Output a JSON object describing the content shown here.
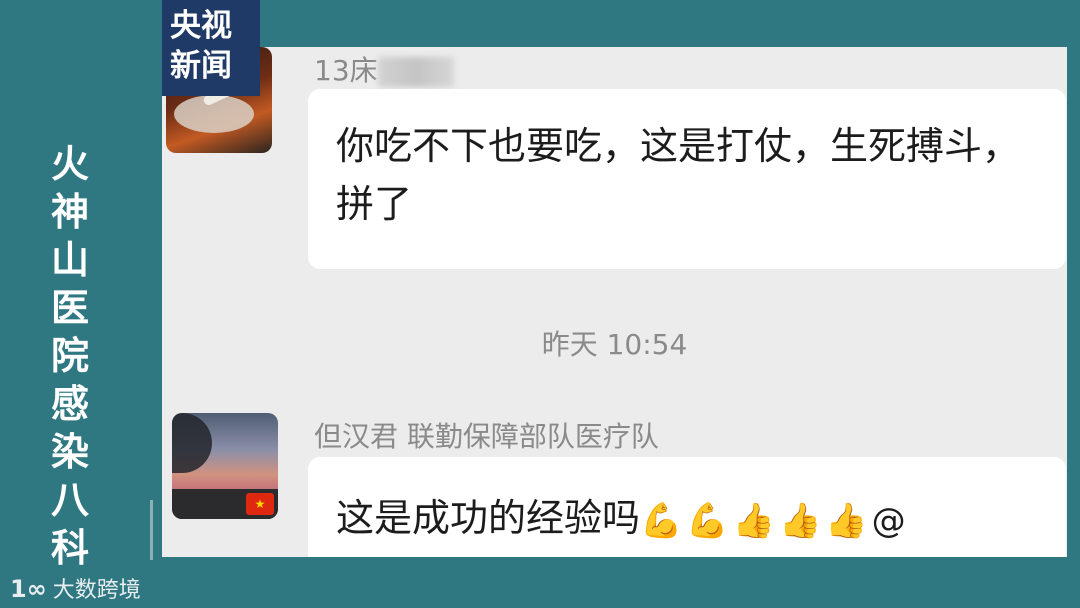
{
  "broadcaster_logo": {
    "line1": "央视",
    "line2": "新闻"
  },
  "side_caption": "火神山医院感染八科",
  "chat": {
    "messages": [
      {
        "sender": "13床",
        "sender_blurred": true,
        "text": "你吃不下也要吃，这是打仗，生死搏斗，拼了"
      },
      {
        "sender": "但汉君 联勤保障部队医疗队",
        "text": "这是成功的经验吗",
        "trailing_emojis": "💪💪👍👍👍@"
      }
    ],
    "timestamp": "昨天 10:54"
  },
  "watermark": {
    "mark": "1∞",
    "text": "大数跨境"
  }
}
